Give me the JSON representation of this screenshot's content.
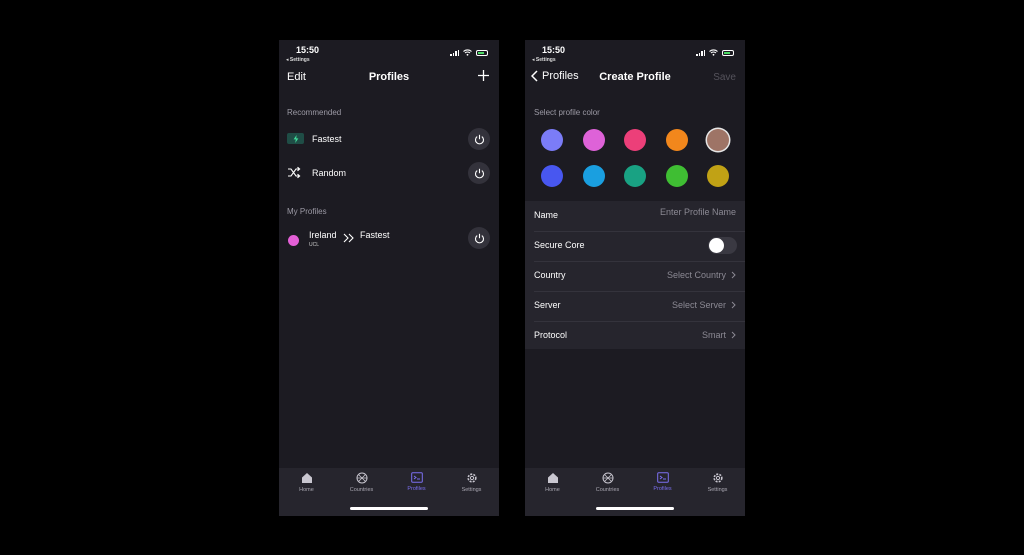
{
  "status_bar": {
    "time": "15:50",
    "back_label": "◂ Settings"
  },
  "profiles_screen": {
    "nav": {
      "edit_label": "Edit",
      "title": "Profiles",
      "add_icon": "plus-icon"
    },
    "recommended_label": "Recommended",
    "recommended": [
      {
        "name": "Fastest",
        "icon": "lightning-flag-icon"
      },
      {
        "name": "Random",
        "icon": "shuffle-icon"
      }
    ],
    "my_profiles_label": "My Profiles",
    "my_profiles": [
      {
        "country": "Ireland",
        "code": "UCL",
        "server": "Fastest",
        "color": "#e35fd6"
      }
    ]
  },
  "create_profile_screen": {
    "nav": {
      "back_label": "Profiles",
      "title": "Create Profile",
      "save_label": "Save"
    },
    "color_label": "Select profile color",
    "colors": [
      "#7b7cf7",
      "#de62d8",
      "#ec3f79",
      "#f2871c",
      "#9e7466",
      "#4857f0",
      "#1a9fe0",
      "#19a283",
      "#3fbe33",
      "#c1a215"
    ],
    "selected_color_index": 4,
    "form": {
      "name_label": "Name",
      "name_placeholder": "Enter Profile Name",
      "secure_core_label": "Secure Core",
      "secure_core_on": false,
      "country_label": "Country",
      "country_value": "Select Country",
      "server_label": "Server",
      "server_value": "Select Server",
      "protocol_label": "Protocol",
      "protocol_value": "Smart"
    }
  },
  "tab_bar": {
    "tabs": [
      {
        "label": "Home",
        "icon": "home-icon"
      },
      {
        "label": "Countries",
        "icon": "globe-icon"
      },
      {
        "label": "Profiles",
        "icon": "profiles-icon"
      },
      {
        "label": "Settings",
        "icon": "gear-icon"
      }
    ],
    "active_index": 2,
    "active_color": "#7b6ff0"
  }
}
